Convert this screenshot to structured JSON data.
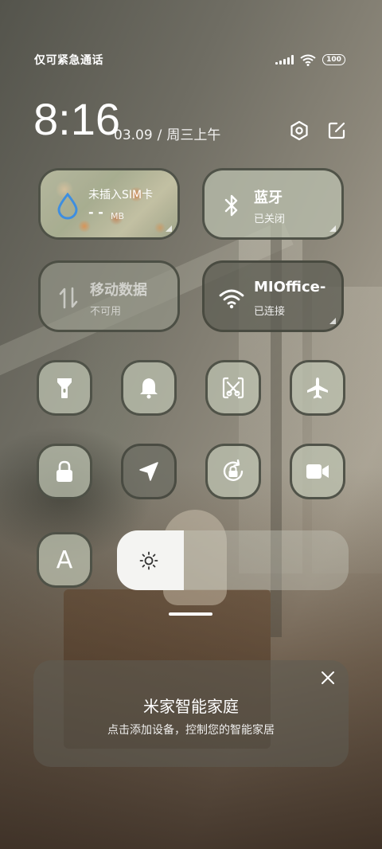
{
  "status_bar": {
    "carrier": "仅可紧急通话",
    "battery": "100",
    "icons": [
      "signal-icon",
      "wifi-icon",
      "battery-icon"
    ]
  },
  "header": {
    "time": "8:16",
    "date": "03.09",
    "weekday": "周三上午",
    "icons": [
      "settings-icon",
      "edit-icon"
    ]
  },
  "tiles": {
    "sim": {
      "title": "未插入SIM卡",
      "usage": "- -",
      "unit": "MB"
    },
    "bluetooth": {
      "title": "蓝牙",
      "status": "已关闭"
    },
    "mobile_data": {
      "title": "移动数据",
      "status": "不可用"
    },
    "wifi": {
      "title": "MIOffice-",
      "status": "已连接"
    }
  },
  "toggles": [
    {
      "icon": "flashlight-icon",
      "active": false
    },
    {
      "icon": "bell-icon",
      "active": false
    },
    {
      "icon": "screenshot-icon",
      "active": false
    },
    {
      "icon": "airplane-icon",
      "active": false
    },
    {
      "icon": "lock-icon",
      "active": false
    },
    {
      "icon": "location-icon",
      "active": true
    },
    {
      "icon": "rotation-lock-icon",
      "active": false
    },
    {
      "icon": "video-camera-icon",
      "active": false
    },
    {
      "icon": "auto-brightness-icon",
      "label": "A",
      "active": false
    }
  ],
  "brightness": {
    "level": 0.29
  },
  "smart_home_card": {
    "title": "米家智能家庭",
    "subtitle": "点击添加设备，控制您的智能家居"
  }
}
